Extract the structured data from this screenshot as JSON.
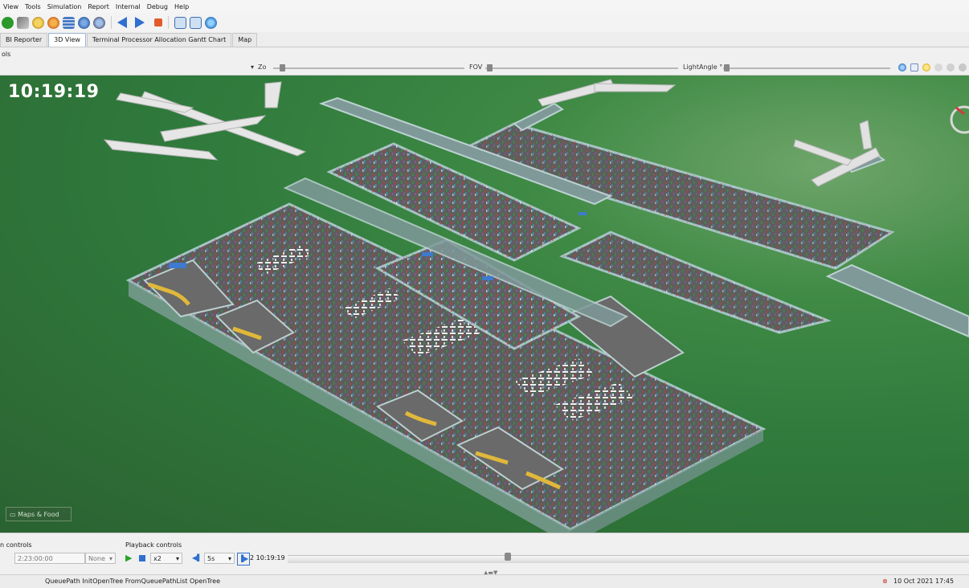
{
  "menu": [
    "View",
    "Tools",
    "Simulation",
    "Report",
    "Internal",
    "Debug",
    "Help"
  ],
  "tabs": [
    {
      "label": "BI Reporter",
      "active": false
    },
    {
      "label": "3D View",
      "active": true
    },
    {
      "label": "Terminal Processor Allocation Gantt Chart",
      "active": false
    },
    {
      "label": "Map",
      "active": false
    }
  ],
  "subbar_text": "ols",
  "sliders": {
    "zoom_label": "Zo",
    "fov_label": "FOV",
    "light_label": "LightAngle °"
  },
  "view": {
    "clock": "10:19:19",
    "maps_food_label": "Maps & Food"
  },
  "bottom": {
    "sim_controls_label": "n controls",
    "sim_time_value": "2:23:00:00",
    "sim_unit": "None",
    "playback_label": "Playback controls",
    "speed": "x2",
    "step": "5s",
    "current_time": "2 10:19:19"
  },
  "status": {
    "message": "QueuePath InitOpenTree FromQueuePathList OpenTree",
    "datetime": "10 Oct 2021 17:45"
  },
  "colors": {
    "floor": "#5f5f5f",
    "wall": "#9fb8b8",
    "ground": "#347b3d",
    "accent": "#2f6fbf"
  }
}
